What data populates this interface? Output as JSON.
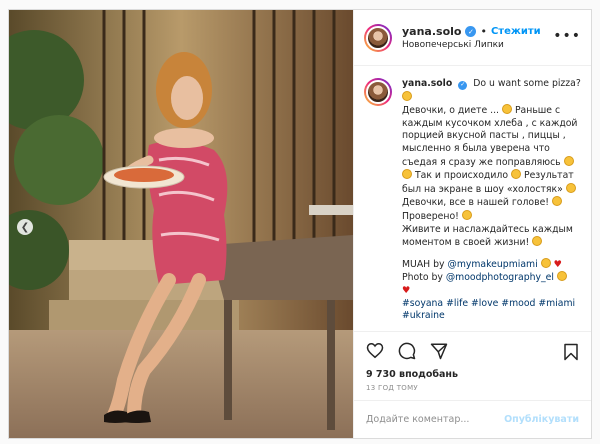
{
  "post": {
    "username": "yana.solo",
    "follow_label": "Стежити",
    "location": "Новопечерські Липки",
    "more_label": "•••"
  },
  "caption": {
    "first_line": "Do u want some pizza?",
    "lines": [
      "Девочки, о диете ...",
      "Раньше с",
      "каждым кусочком хлеба , с каждой",
      "порцией вкусной пасты , пиццы ,",
      "мысленно я была уверена что",
      "съедая я сразу же поправляюсь",
      "Так и происходило",
      "Результат",
      "был на экране в шоу «холостяк»",
      "Девочки, все в нашей голове!",
      "Проверено!",
      "Живите и наслаждайтесь каждым",
      "моментом в своей жизни!"
    ],
    "credit1_prefix": "MUAH by",
    "credit1_tag": "@mymakeupmiami",
    "credit2_prefix": "Photo by",
    "credit2_tag": "@moodphotography_el",
    "hashtags": [
      "#soyana",
      "#life",
      "#love",
      "#mood",
      "#miami",
      "#ukraine"
    ]
  },
  "stats": {
    "likes": "9 730 вподобань",
    "time": "13 ГОД ТОМУ"
  },
  "comment": {
    "placeholder": "Додайте коментар...",
    "publish_label": "Опублікувати"
  },
  "icons": {
    "verified": "verified-badge-icon",
    "like": "heart-icon",
    "comment": "comment-icon",
    "share": "share-icon",
    "save": "bookmark-icon",
    "prev": "chevron-left-icon"
  },
  "colors": {
    "accent": "#0095f6",
    "verified": "#3897f0",
    "hashtag": "#00376b",
    "muted": "#8e8e8e"
  }
}
